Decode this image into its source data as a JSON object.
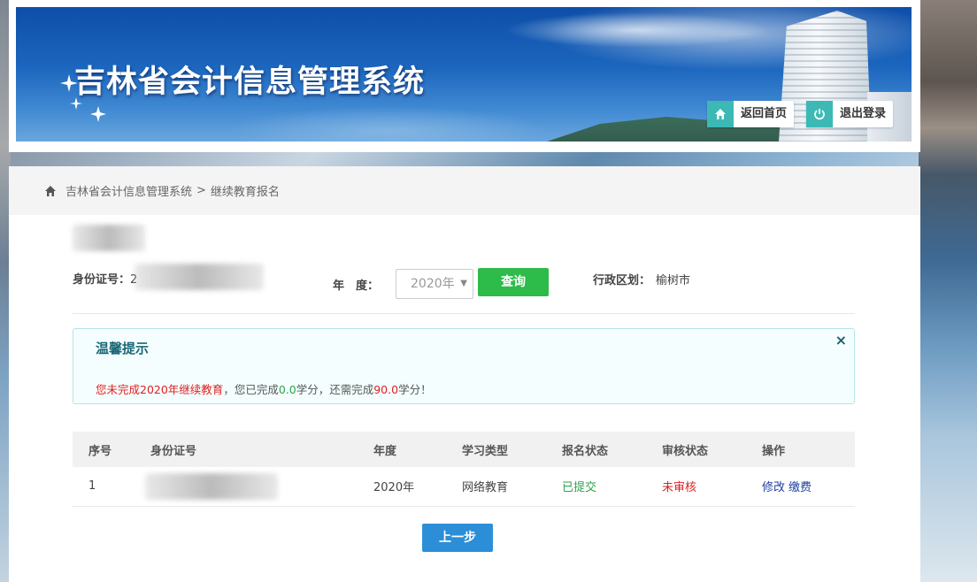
{
  "header": {
    "site_title": "吉林省会计信息管理系统",
    "home_button_label": "返回首页",
    "home_icon": "home-icon",
    "logout_button_label": "退出登录",
    "logout_icon": "power-icon"
  },
  "breadcrumb": {
    "home_icon": "home-icon",
    "items": [
      "吉林省会计信息管理系统",
      "继续教育报名"
    ],
    "separator": ">"
  },
  "filters": {
    "id_label": "身份证号：",
    "id_value_prefix": "2",
    "year_label": "年　度：",
    "year_selected": "2020年",
    "query_button_label": "查询",
    "district_label": "行政区划：",
    "district_value": "榆树市"
  },
  "notice": {
    "title": "温馨提示",
    "close_symbol": "×",
    "msg_red": "您未完成2020年继续教育",
    "msg_part1": "，您已完成",
    "completed_credits": "0.0",
    "msg_part2": "学分，还需完成",
    "required_credits": "90.0",
    "msg_part3": "学分！"
  },
  "table": {
    "headers": [
      "序号",
      "身份证号",
      "年度",
      "学习类型",
      "报名状态",
      "审核状态",
      "操作"
    ],
    "rows": [
      {
        "index": "1",
        "year": "2020年",
        "study_type": "网络教育",
        "enroll_status": "已提交",
        "review_status": "未审核",
        "action_edit": "修改",
        "action_pay": "缴费"
      }
    ]
  },
  "footer": {
    "prev_button_label": "上一步"
  },
  "colors": {
    "accent_teal": "#3cb9b5",
    "query_green": "#2dbb4a",
    "prev_blue": "#2d8ed8",
    "status_green": "#2aa34a",
    "status_red": "#e02020"
  }
}
